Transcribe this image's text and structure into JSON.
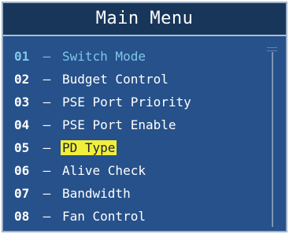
{
  "window": {
    "title": "Main Menu"
  },
  "menu": {
    "items": [
      {
        "number": "01",
        "separator": "–",
        "label": "Switch Mode",
        "state": "active"
      },
      {
        "number": "02",
        "separator": "–",
        "label": "Budget Control",
        "state": "normal"
      },
      {
        "number": "03",
        "separator": "–",
        "label": "PSE Port Priority",
        "state": "normal"
      },
      {
        "number": "04",
        "separator": "–",
        "label": "PSE Port Enable",
        "state": "normal"
      },
      {
        "number": "05",
        "separator": "–",
        "label": "PD Type",
        "state": "highlighted"
      },
      {
        "number": "06",
        "separator": "–",
        "label": "Alive Check",
        "state": "normal"
      },
      {
        "number": "07",
        "separator": "–",
        "label": "Bandwidth",
        "state": "normal"
      },
      {
        "number": "08",
        "separator": "–",
        "label": "Fan Control",
        "state": "normal"
      }
    ]
  },
  "colors": {
    "background": "#26518a",
    "title_bar": "#18365a",
    "text": "#ffffff",
    "active_text": "#7fc7ea",
    "highlight": "#f2ef3c"
  }
}
